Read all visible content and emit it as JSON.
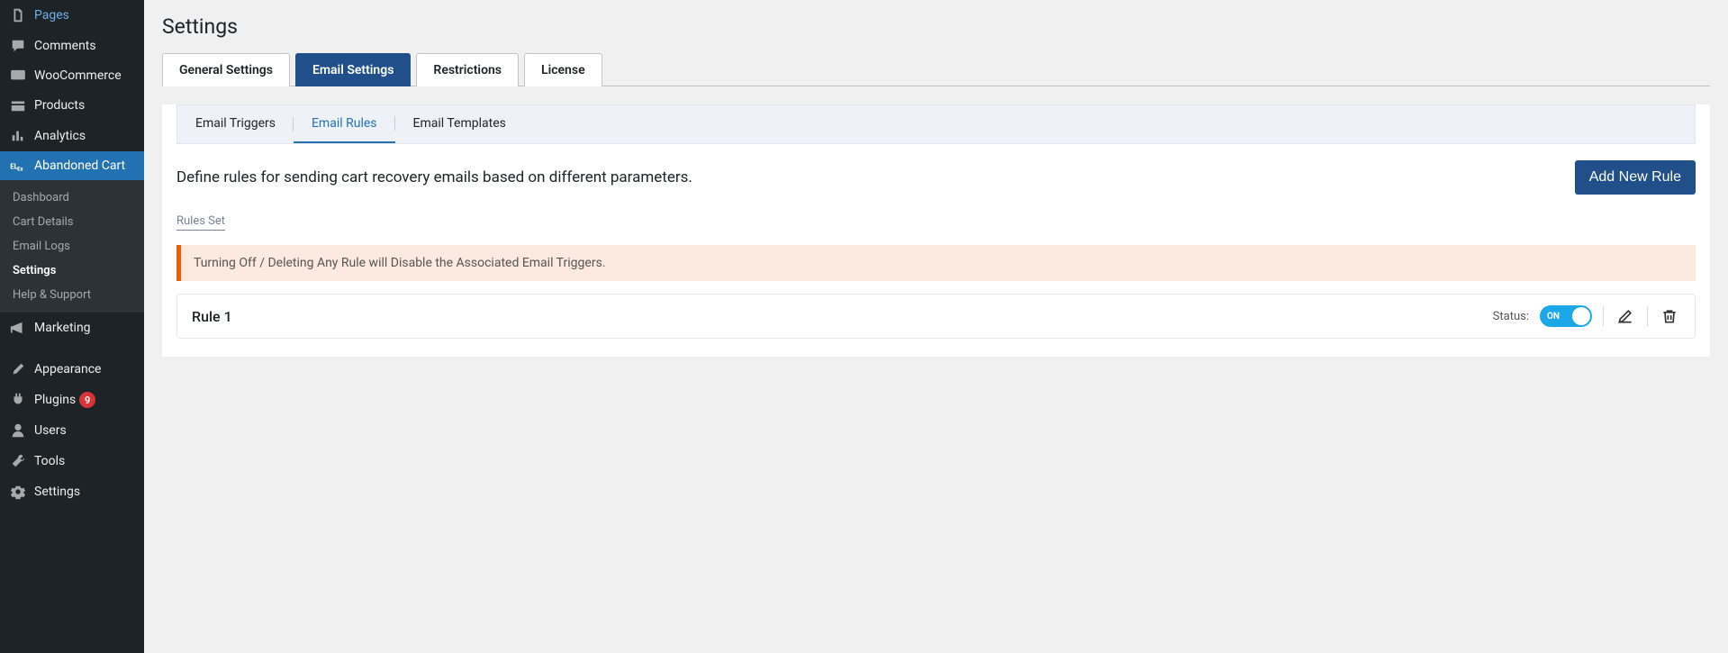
{
  "sidebar": {
    "items": [
      {
        "label": "Pages"
      },
      {
        "label": "Comments"
      },
      {
        "label": "WooCommerce"
      },
      {
        "label": "Products"
      },
      {
        "label": "Analytics"
      },
      {
        "label": "Abandoned Cart"
      },
      {
        "label": "Marketing"
      },
      {
        "label": "Appearance"
      },
      {
        "label": "Plugins"
      },
      {
        "label": "Users"
      },
      {
        "label": "Tools"
      },
      {
        "label": "Settings"
      }
    ],
    "plugins_badge": "9",
    "submenu": [
      {
        "label": "Dashboard"
      },
      {
        "label": "Cart Details"
      },
      {
        "label": "Email Logs"
      },
      {
        "label": "Settings"
      },
      {
        "label": "Help & Support"
      }
    ]
  },
  "page": {
    "title": "Settings"
  },
  "tabs": {
    "items": [
      {
        "label": "General Settings"
      },
      {
        "label": "Email Settings"
      },
      {
        "label": "Restrictions"
      },
      {
        "label": "License"
      }
    ]
  },
  "subtabs": {
    "items": [
      {
        "label": "Email Triggers"
      },
      {
        "label": "Email Rules"
      },
      {
        "label": "Email Templates"
      }
    ]
  },
  "content": {
    "description": "Define rules for sending cart recovery emails based on different parameters.",
    "add_button": "Add New Rule",
    "rules_set_label": "Rules Set",
    "warning": "Turning Off / Deleting Any Rule will Disable the Associated Email Triggers."
  },
  "rules": [
    {
      "title": "Rule 1",
      "status_label": "Status:",
      "toggle_text": "ON"
    }
  ]
}
